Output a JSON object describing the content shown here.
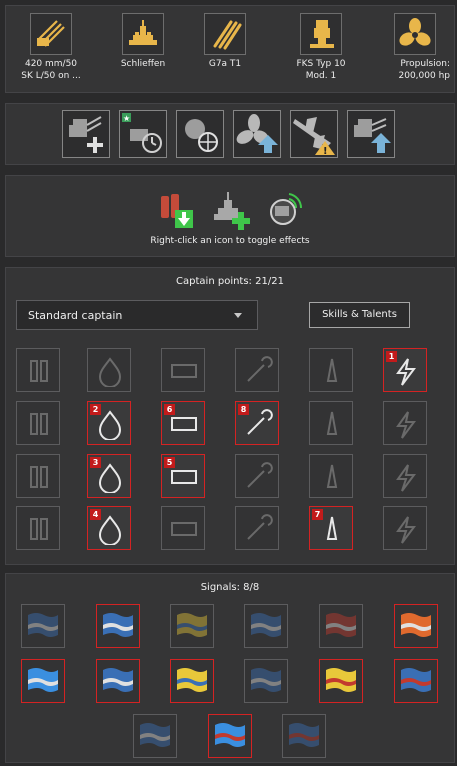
{
  "modules": [
    {
      "name": "main-battery",
      "icon": "gun-battery-icon",
      "label": "420 mm/50\nSK L/50 on ..."
    },
    {
      "name": "hull",
      "icon": "battleship-hull-icon",
      "label": "Schlieffen"
    },
    {
      "name": "torpedoes",
      "icon": "torpedo-icon",
      "label": "G7a T1"
    },
    {
      "name": "fire-control",
      "icon": "fire-control-icon",
      "label": "FKS Typ 10\nMod. 1"
    },
    {
      "name": "engine",
      "icon": "propeller-icon",
      "label": "Propulsion:\n200,000 hp"
    }
  ],
  "upgrades": [
    {
      "icon": "main-armaments-mod-icon"
    },
    {
      "icon": "special-upgrade-icon"
    },
    {
      "icon": "aiming-systems-mod-icon"
    },
    {
      "icon": "propulsion-mod-icon"
    },
    {
      "icon": "aircraft-mod-icon"
    },
    {
      "icon": "secondary-battery-mod-icon"
    }
  ],
  "consumables": {
    "items": [
      {
        "icon": "damage-control-party-icon"
      },
      {
        "icon": "repair-party-icon"
      },
      {
        "icon": "hydroacoustic-search-icon"
      }
    ],
    "hint": "Right-click an icon to toggle effects"
  },
  "captain": {
    "title": "Captain points: 21/21",
    "dropdown_value": "Standard captain",
    "skills_button": "Skills & Talents",
    "skills": [
      {
        "icon": "grease-the-gears-icon",
        "order": null
      },
      {
        "icon": "fire-prevention-icon",
        "order": null
      },
      {
        "icon": "gun-feeder-icon",
        "order": null
      },
      {
        "icon": "priority-target-icon",
        "order": null
      },
      {
        "icon": "incoming-fire-alert-icon",
        "order": null
      },
      {
        "icon": "emergency-repair-icon",
        "order": "1"
      },
      {
        "icon": "adrenaline-rush-icon",
        "order": null
      },
      {
        "icon": "close-quarters-combat-icon",
        "order": "2"
      },
      {
        "icon": "improved-repair-party-icon",
        "order": "6"
      },
      {
        "icon": "vigilance-icon",
        "order": "8"
      },
      {
        "icon": "concealment-expert-icon",
        "order": null
      },
      {
        "icon": "secondary-armament-expert-icon",
        "order": null
      },
      {
        "icon": "basic-firing-training-icon",
        "order": null
      },
      {
        "icon": "fire-control-expert-icon",
        "order": "3"
      },
      {
        "icon": "brisk-icon",
        "order": "5"
      },
      {
        "icon": "superintendent-icon",
        "order": null
      },
      {
        "icon": "heavy-armor-icon",
        "order": null
      },
      {
        "icon": "manual-secondary-icon",
        "order": null
      },
      {
        "icon": "dead-eye-icon",
        "order": null
      },
      {
        "icon": "manual-aa-icon",
        "order": "4"
      },
      {
        "icon": "inertia-fuse-icon",
        "order": null
      },
      {
        "icon": "repair-specialist-icon",
        "order": null
      },
      {
        "icon": "situational-awareness-icon",
        "order": "7"
      },
      {
        "icon": "fire-extinguisher-icon",
        "order": null
      }
    ]
  },
  "signals": {
    "title": "Signals: 8/8",
    "flags": [
      {
        "icon": "flag-checker-blue-icon",
        "selected": false
      },
      {
        "icon": "flag-blue-cross-icon",
        "selected": true
      },
      {
        "icon": "flag-yellow-blue-icon",
        "selected": false
      },
      {
        "icon": "flag-blue-stripes-icon",
        "selected": false
      },
      {
        "icon": "flag-red-diagonal-icon",
        "selected": false
      },
      {
        "icon": "flag-orange-white-icon",
        "selected": true
      },
      {
        "icon": "flag-checker-blue-icon",
        "selected": true
      },
      {
        "icon": "flag-blue-cross-square-icon",
        "selected": true
      },
      {
        "icon": "flag-yellow-plus-icon",
        "selected": true
      },
      {
        "icon": "flag-blue-white-icon",
        "selected": false
      },
      {
        "icon": "flag-yellow-red-icon",
        "selected": true
      },
      {
        "icon": "flag-blue-red-yellow-icon",
        "selected": true
      },
      {
        "icon": "flag-blue-white-diagonal-icon",
        "selected": false
      },
      {
        "icon": "flag-blue-square-red-icon",
        "selected": true
      },
      {
        "icon": "flag-blue-red-stripes-icon",
        "selected": false
      }
    ]
  },
  "colors": {
    "selected_border": "#d42323",
    "badge": "#c21b1b",
    "module_gold": "#e8b64a",
    "upgrade_arrow": "#7ab3d8",
    "consumable_green": "#3fc64a"
  }
}
